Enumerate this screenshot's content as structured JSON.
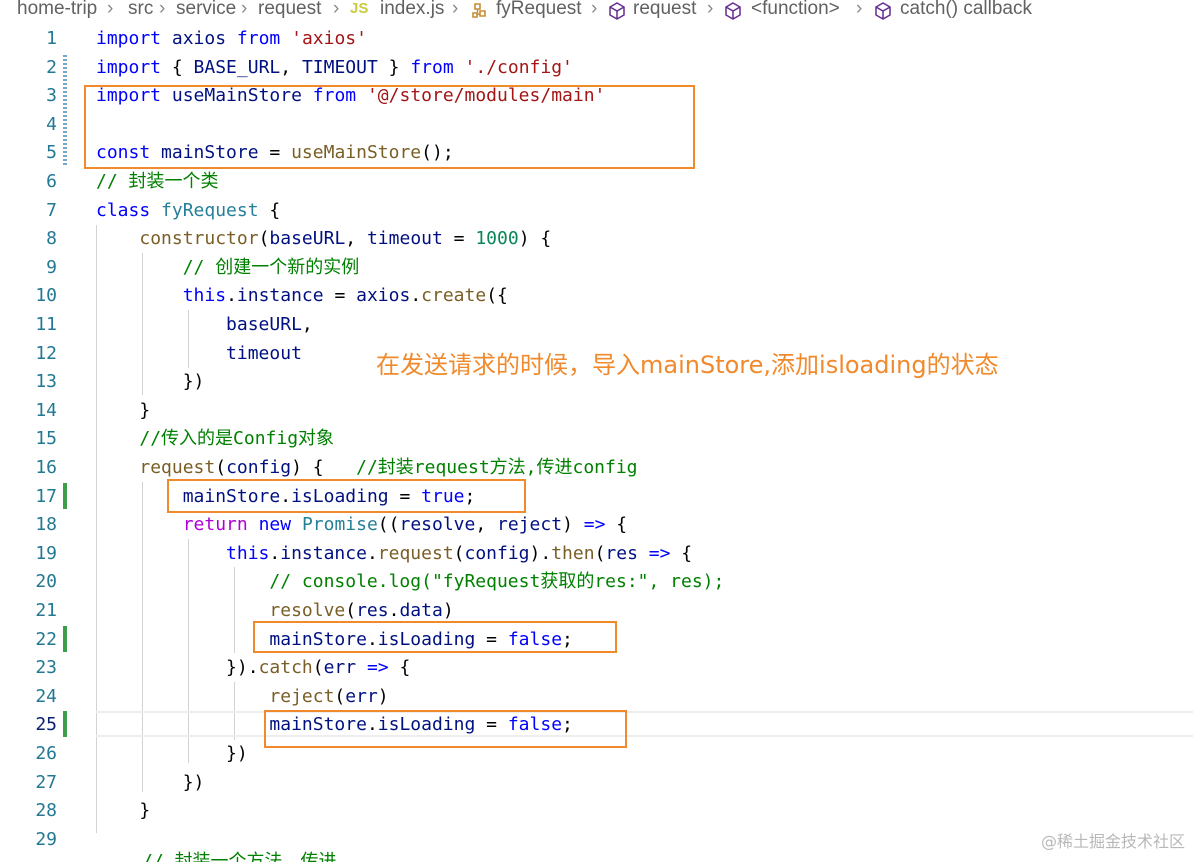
{
  "breadcrumb": {
    "items": [
      "home-trip",
      "src",
      "service",
      "request",
      "index.js",
      "fyRequest",
      "request",
      "<function>",
      "catch() callback"
    ],
    "js_badge": "JS"
  },
  "editor": {
    "lines": [
      {
        "n": "1",
        "tokens": [
          [
            "kw",
            "import"
          ],
          [
            "plain",
            " "
          ],
          [
            "var",
            "axios"
          ],
          [
            "plain",
            " "
          ],
          [
            "kw",
            "from"
          ],
          [
            "plain",
            " "
          ],
          [
            "str",
            "'axios'"
          ]
        ]
      },
      {
        "n": "2",
        "tokens": [
          [
            "kw",
            "import"
          ],
          [
            "plain",
            " { "
          ],
          [
            "var",
            "BASE_URL"
          ],
          [
            "plain",
            ", "
          ],
          [
            "var",
            "TIMEOUT"
          ],
          [
            "plain",
            " } "
          ],
          [
            "kw",
            "from"
          ],
          [
            "plain",
            " "
          ],
          [
            "str",
            "'./config'"
          ]
        ]
      },
      {
        "n": "3",
        "tokens": [
          [
            "kw",
            "import"
          ],
          [
            "plain",
            " "
          ],
          [
            "var",
            "useMainStore"
          ],
          [
            "plain",
            " "
          ],
          [
            "kw",
            "from"
          ],
          [
            "plain",
            " "
          ],
          [
            "str",
            "'@/store/modules/main'"
          ]
        ]
      },
      {
        "n": "4",
        "tokens": []
      },
      {
        "n": "5",
        "tokens": [
          [
            "kw",
            "const"
          ],
          [
            "plain",
            " "
          ],
          [
            "var",
            "mainStore"
          ],
          [
            "plain",
            " = "
          ],
          [
            "fn",
            "useMainStore"
          ],
          [
            "plain",
            "();"
          ]
        ]
      },
      {
        "n": "6",
        "tokens": [
          [
            "cmt",
            "// 封装一个类"
          ]
        ]
      },
      {
        "n": "7",
        "tokens": [
          [
            "kw",
            "class"
          ],
          [
            "plain",
            " "
          ],
          [
            "cls",
            "fyRequest"
          ],
          [
            "plain",
            " {"
          ]
        ]
      },
      {
        "n": "8",
        "tokens": [
          [
            "plain",
            "    "
          ],
          [
            "fn",
            "constructor"
          ],
          [
            "plain",
            "("
          ],
          [
            "var",
            "baseURL"
          ],
          [
            "plain",
            ", "
          ],
          [
            "var",
            "timeout"
          ],
          [
            "plain",
            " = "
          ],
          [
            "num",
            "1000"
          ],
          [
            "plain",
            ") {"
          ]
        ]
      },
      {
        "n": "9",
        "tokens": [
          [
            "plain",
            "        "
          ],
          [
            "cmt",
            "// 创建一个新的实例"
          ]
        ]
      },
      {
        "n": "10",
        "tokens": [
          [
            "plain",
            "        "
          ],
          [
            "kw",
            "this"
          ],
          [
            "plain",
            "."
          ],
          [
            "var",
            "instance"
          ],
          [
            "plain",
            " = "
          ],
          [
            "var",
            "axios"
          ],
          [
            "plain",
            "."
          ],
          [
            "fn",
            "create"
          ],
          [
            "plain",
            "({"
          ]
        ]
      },
      {
        "n": "11",
        "tokens": [
          [
            "plain",
            "            "
          ],
          [
            "var",
            "baseURL"
          ],
          [
            "plain",
            ","
          ]
        ]
      },
      {
        "n": "12",
        "tokens": [
          [
            "plain",
            "            "
          ],
          [
            "var",
            "timeout"
          ]
        ]
      },
      {
        "n": "13",
        "tokens": [
          [
            "plain",
            "        })"
          ]
        ]
      },
      {
        "n": "14",
        "tokens": [
          [
            "plain",
            "    }"
          ]
        ]
      },
      {
        "n": "15",
        "tokens": [
          [
            "plain",
            "    "
          ],
          [
            "cmt",
            "//传入的是Config对象"
          ]
        ]
      },
      {
        "n": "16",
        "tokens": [
          [
            "plain",
            "    "
          ],
          [
            "fn",
            "request"
          ],
          [
            "plain",
            "("
          ],
          [
            "var",
            "config"
          ],
          [
            "plain",
            ") {   "
          ],
          [
            "cmt",
            "//封装request方法,传进config"
          ]
        ]
      },
      {
        "n": "17",
        "tokens": [
          [
            "plain",
            "        "
          ],
          [
            "var",
            "mainStore"
          ],
          [
            "plain",
            "."
          ],
          [
            "var",
            "isLoading"
          ],
          [
            "plain",
            " = "
          ],
          [
            "kw",
            "true"
          ],
          [
            "plain",
            ";"
          ]
        ]
      },
      {
        "n": "18",
        "tokens": [
          [
            "plain",
            "        "
          ],
          [
            "ctl",
            "return"
          ],
          [
            "plain",
            " "
          ],
          [
            "kw",
            "new"
          ],
          [
            "plain",
            " "
          ],
          [
            "cls",
            "Promise"
          ],
          [
            "plain",
            "(("
          ],
          [
            "var",
            "resolve"
          ],
          [
            "plain",
            ", "
          ],
          [
            "var",
            "reject"
          ],
          [
            "plain",
            ") "
          ],
          [
            "kw",
            "=>"
          ],
          [
            "plain",
            " {"
          ]
        ]
      },
      {
        "n": "19",
        "tokens": [
          [
            "plain",
            "            "
          ],
          [
            "kw",
            "this"
          ],
          [
            "plain",
            "."
          ],
          [
            "var",
            "instance"
          ],
          [
            "plain",
            "."
          ],
          [
            "fn",
            "request"
          ],
          [
            "plain",
            "("
          ],
          [
            "var",
            "config"
          ],
          [
            "plain",
            ")."
          ],
          [
            "fn",
            "then"
          ],
          [
            "plain",
            "("
          ],
          [
            "var",
            "res"
          ],
          [
            "plain",
            " "
          ],
          [
            "kw",
            "=>"
          ],
          [
            "plain",
            " {"
          ]
        ]
      },
      {
        "n": "20",
        "tokens": [
          [
            "plain",
            "                "
          ],
          [
            "cmt",
            "// console.log(\"fyRequest获取的res:\", res);"
          ]
        ]
      },
      {
        "n": "21",
        "tokens": [
          [
            "plain",
            "                "
          ],
          [
            "fn",
            "resolve"
          ],
          [
            "plain",
            "("
          ],
          [
            "var",
            "res"
          ],
          [
            "plain",
            "."
          ],
          [
            "var",
            "data"
          ],
          [
            "plain",
            ")"
          ]
        ]
      },
      {
        "n": "22",
        "tokens": [
          [
            "plain",
            "                "
          ],
          [
            "var",
            "mainStore"
          ],
          [
            "plain",
            "."
          ],
          [
            "var",
            "isLoading"
          ],
          [
            "plain",
            " = "
          ],
          [
            "kw",
            "false"
          ],
          [
            "plain",
            ";"
          ]
        ]
      },
      {
        "n": "23",
        "tokens": [
          [
            "plain",
            "            })."
          ],
          [
            "fn",
            "catch"
          ],
          [
            "plain",
            "("
          ],
          [
            "var",
            "err"
          ],
          [
            "plain",
            " "
          ],
          [
            "kw",
            "=>"
          ],
          [
            "plain",
            " {"
          ]
        ]
      },
      {
        "n": "24",
        "tokens": [
          [
            "plain",
            "                "
          ],
          [
            "fn",
            "reject"
          ],
          [
            "plain",
            "("
          ],
          [
            "var",
            "err"
          ],
          [
            "plain",
            ")"
          ]
        ]
      },
      {
        "n": "25",
        "tokens": [
          [
            "plain",
            "                "
          ],
          [
            "var",
            "mainStore"
          ],
          [
            "plain",
            "."
          ],
          [
            "var",
            "isLoading"
          ],
          [
            "plain",
            " = "
          ],
          [
            "kw",
            "false"
          ],
          [
            "plain",
            ";"
          ]
        ]
      },
      {
        "n": "26",
        "tokens": [
          [
            "plain",
            "            })"
          ]
        ]
      },
      {
        "n": "27",
        "tokens": [
          [
            "plain",
            "        })"
          ]
        ]
      },
      {
        "n": "28",
        "tokens": [
          [
            "plain",
            "    }"
          ]
        ]
      },
      {
        "n": "29",
        "tokens": []
      }
    ],
    "partial_next_line": "// 封装一个方法，传进"
  },
  "annotation": "在发送请求的时候，导入mainStore,添加isloading的状态",
  "watermark": "@稀土掘金技术社区",
  "colors": {
    "highlight_box": "#f08a2c",
    "keyword": "#0000ff",
    "string": "#a31515",
    "comment": "#008000",
    "function": "#795e26",
    "variable": "#001080",
    "git_added": "#3c9e49"
  }
}
